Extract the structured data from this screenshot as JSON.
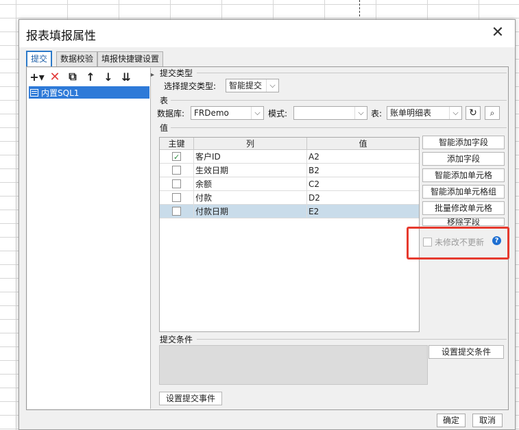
{
  "dialog": {
    "title": "报表填报属性"
  },
  "tabs": [
    {
      "label": "提交",
      "active": true
    },
    {
      "label": "数据校验",
      "active": false
    },
    {
      "label": "填报快捷键设置",
      "active": false
    }
  ],
  "toolbar": {
    "add": "+▾",
    "delete": "✕",
    "copy": "⧉",
    "up": "↑",
    "down": "↓",
    "sort": "⇊"
  },
  "tree": {
    "items": [
      "内置SQL1"
    ]
  },
  "submit_type": {
    "section": "提交类型",
    "label": "选择提交类型:",
    "value": "智能提交"
  },
  "table_section": {
    "section": "表",
    "db_label": "数据库:",
    "db_value": "FRDemo",
    "mode_label": "模式:",
    "mode_value": "",
    "table_label": "表:",
    "table_value": "账单明细表"
  },
  "value_section": {
    "section": "值",
    "columns": [
      "主键",
      "列",
      "值"
    ],
    "rows": [
      {
        "key": true,
        "col": "客户ID",
        "val": "A2"
      },
      {
        "key": false,
        "col": "生效日期",
        "val": "B2"
      },
      {
        "key": false,
        "col": "余额",
        "val": "C2"
      },
      {
        "key": false,
        "col": "付款",
        "val": "D2"
      },
      {
        "key": false,
        "col": "付款日期",
        "val": "E2"
      }
    ]
  },
  "side_buttons": [
    "智能添加字段",
    "添加字段",
    "智能添加单元格",
    "智能添加单元格组",
    "批量修改单元格",
    "移除字段"
  ],
  "unmodified_label": "未修改不更新",
  "help_glyph": "?",
  "conditions": {
    "section": "提交条件",
    "set_button": "设置提交条件",
    "event_button": "设置提交事件"
  },
  "footer": {
    "ok": "确定",
    "cancel": "取消"
  },
  "colors": {
    "accent": "#2e7ad8",
    "highlight": "#e63a2e",
    "selected_row": "#c9dcea"
  }
}
